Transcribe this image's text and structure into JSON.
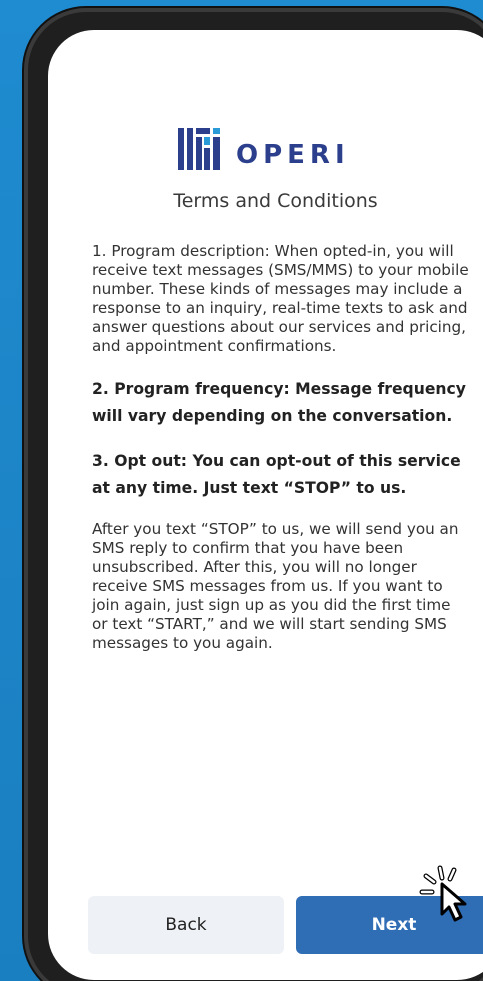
{
  "brand": {
    "name": "OPERI",
    "color": "#2b3f8c"
  },
  "screen": {
    "title": "Terms and Conditions",
    "paragraphs": [
      "1. Program description: When opted-in, you will receive text messages (SMS/MMS) to your mobile number. These kinds of messages may include a response to an inquiry, real-time texts to ask and answer questions about our services and pricing, and appointment confirmations.",
      "2. Program frequency: Message frequency will vary depending on the conversation.",
      "3. Opt out: You can opt-out of this service at any time. Just text “STOP” to us.",
      "After you text “STOP” to us, we will send you an SMS reply to confirm that you have been unsubscribed. After this, you will no longer receive SMS messages from us. If you want to join again, just sign up as you did the first time or text “START,” and we will start sending SMS messages to you again."
    ]
  },
  "actions": {
    "back_label": "Back",
    "next_label": "Next"
  },
  "colors": {
    "background": "#1c86c9",
    "primary_button": "#2f6db5",
    "secondary_button": "#eef1f5"
  },
  "icons": {
    "logo": "operi-logo-icon",
    "cursor": "click-cursor-icon"
  }
}
